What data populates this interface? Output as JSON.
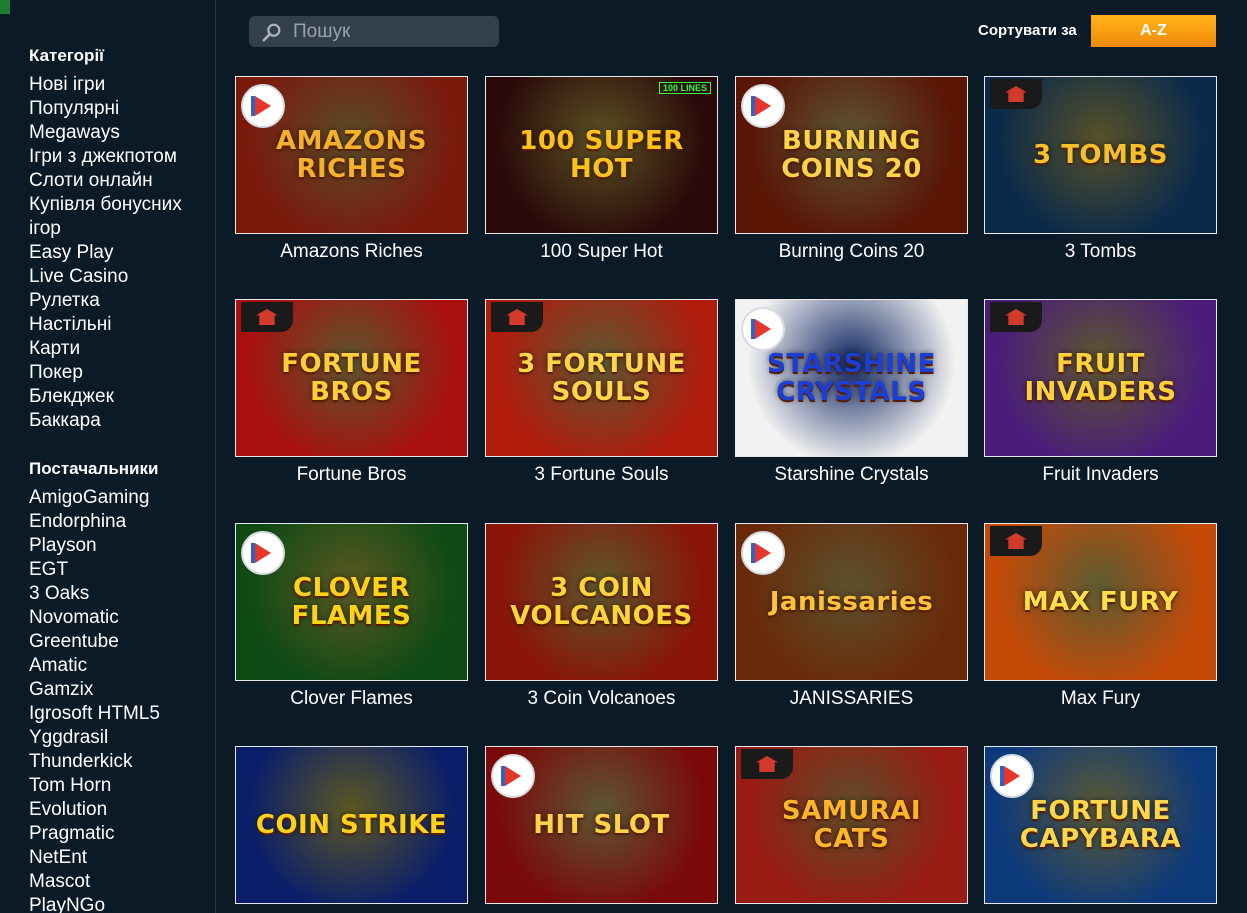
{
  "search": {
    "placeholder": "Пошук",
    "icon": "search-icon"
  },
  "sort": {
    "label": "Сортувати за",
    "button": "A-Z",
    "accent": "#f7a114"
  },
  "sidebar": {
    "categories_title": "Категорії",
    "categories": [
      "Нові ігри",
      "Популярні",
      "Megaways",
      "Ігри з джекпотом",
      "Слоти онлайн",
      "Купівля бонусних ігор",
      "Easy Play",
      "Live Casino",
      "Рулетка",
      "Настільні",
      "Карти",
      "Покер",
      "Блекджек",
      "Баккара"
    ],
    "providers_title": "Постачальники",
    "providers": [
      "AmigoGaming",
      "Endorphina",
      "Playson",
      "EGT",
      "3 Oaks",
      "Novomatic",
      "Greentube",
      "Amatic",
      "Gamzix",
      "Igrosoft HTML5",
      "Yggdrasil",
      "Thunderkick",
      "Tom Horn",
      "Evolution",
      "Pragmatic",
      "NetEnt",
      "Mascot",
      "PlayNGo"
    ]
  },
  "games": [
    {
      "title": "Amazons Riches",
      "art": "AMAZONS RICHES",
      "badge": "endorphina",
      "bg": "#7a1a0d",
      "accent": "#f6b12b"
    },
    {
      "title": "100 Super Hot",
      "art": "100 SUPER HOT",
      "badge": "100lines",
      "badge_text": "100 LINES",
      "bg": "#2a0a0a",
      "accent": "#ffc21a"
    },
    {
      "title": "Burning Coins 20",
      "art": "BURNING COINS 20",
      "badge": "endorphina",
      "bg": "#5a1505",
      "accent": "#ffd24a"
    },
    {
      "title": "3 Tombs",
      "art": "3 TOMBS",
      "badge": "temple",
      "bg": "#0a2a4a",
      "accent": "#f5c02c"
    },
    {
      "title": "Fortune Bros",
      "art": "FORTUNE BROS",
      "badge": "temple",
      "bg": "#a81010",
      "accent": "#ffcf3a"
    },
    {
      "title": "3 Fortune Souls",
      "art": "3 FORTUNE SOULS",
      "badge": "temple",
      "bg": "#b01c0c",
      "accent": "#ffd54a"
    },
    {
      "title": "Starshine Crystals",
      "art": "STARSHINE CRYSTALS",
      "badge": "endorphina",
      "bg": "#f2f2f2",
      "accent": "#1b3fd6"
    },
    {
      "title": "Fruit Invaders",
      "art": "FRUIT INVADERS",
      "badge": "temple",
      "bg": "#4b1d7a",
      "accent": "#ffd13a"
    },
    {
      "title": "Clover Flames",
      "art": "CLOVER FLAMES",
      "badge": "endorphina",
      "bg": "#0f4a14",
      "accent": "#ffd21a"
    },
    {
      "title": "3 Coin Volcanoes",
      "art": "3 COIN VOLCANOES",
      "badge": "none",
      "bg": "#8a1408",
      "accent": "#ffd43a"
    },
    {
      "title": "JANISSARIES",
      "art": "Janissaries",
      "badge": "endorphina",
      "bg": "#6a2a0a",
      "accent": "#ffc23a"
    },
    {
      "title": "Max Fury",
      "art": "MAX FURY",
      "badge": "temple",
      "bg": "#c44a08",
      "accent": "#ffe04a"
    },
    {
      "title": "",
      "art": "COIN STRIKE",
      "badge": "none",
      "bg": "#0a1e6a",
      "accent": "#ffd21a"
    },
    {
      "title": "",
      "art": "HIT SLOT",
      "badge": "endorphina",
      "bg": "#7a0a0a",
      "accent": "#ffd24a"
    },
    {
      "title": "",
      "art": "SAMURAI CATS",
      "badge": "temple",
      "bg": "#9a1a14",
      "accent": "#ffb52a"
    },
    {
      "title": "",
      "art": "FORTUNE CAPYBARA",
      "badge": "endorphina",
      "bg": "#0d3a7a",
      "accent": "#ffd64a"
    }
  ]
}
